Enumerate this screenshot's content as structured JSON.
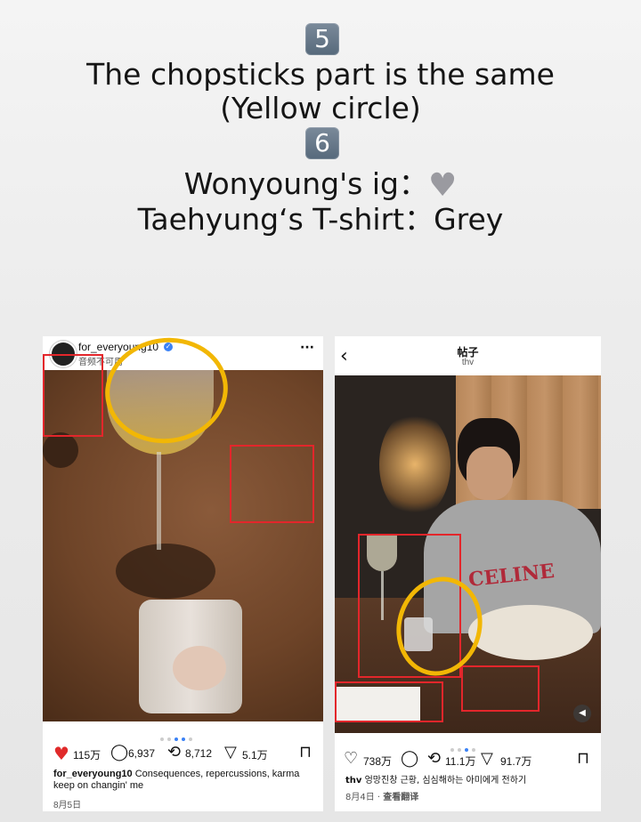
{
  "captions": {
    "badge_5": "5",
    "line_5a": "The chopsticks part is the same",
    "line_5b": "(Yellow circle)",
    "badge_6": "6",
    "line_6a": "Wonyoung's ig：",
    "line_6b": "Taehyung‘s T-shirt：Grey"
  },
  "left_post": {
    "username": "for_everyoung10",
    "subtitle": "音频不可用",
    "more": "···",
    "likes": "115万",
    "comments": "6,937",
    "reposts": "8,712",
    "shares": "5.1万",
    "caption_user": "for_everyoung10",
    "caption_text": "Consequences, repercussions, karma keep on changin' me",
    "date": "8月5日"
  },
  "right_post": {
    "header_title": "帖子",
    "header_sub": "thv",
    "shirt_text": "CELINE",
    "likes": "738万",
    "reposts": "11.1万",
    "shares": "91.7万",
    "caption_user": "thv",
    "caption_text": "엉망진창 근황, 심심해하는 아미에게 전하기",
    "date": "8月4日",
    "translate": "查看翻译"
  },
  "colors": {
    "annotation_red": "#e3262b",
    "annotation_yellow": "#f2b705",
    "like_red": "#e02a2a",
    "dot_active": "#3b82f6"
  }
}
